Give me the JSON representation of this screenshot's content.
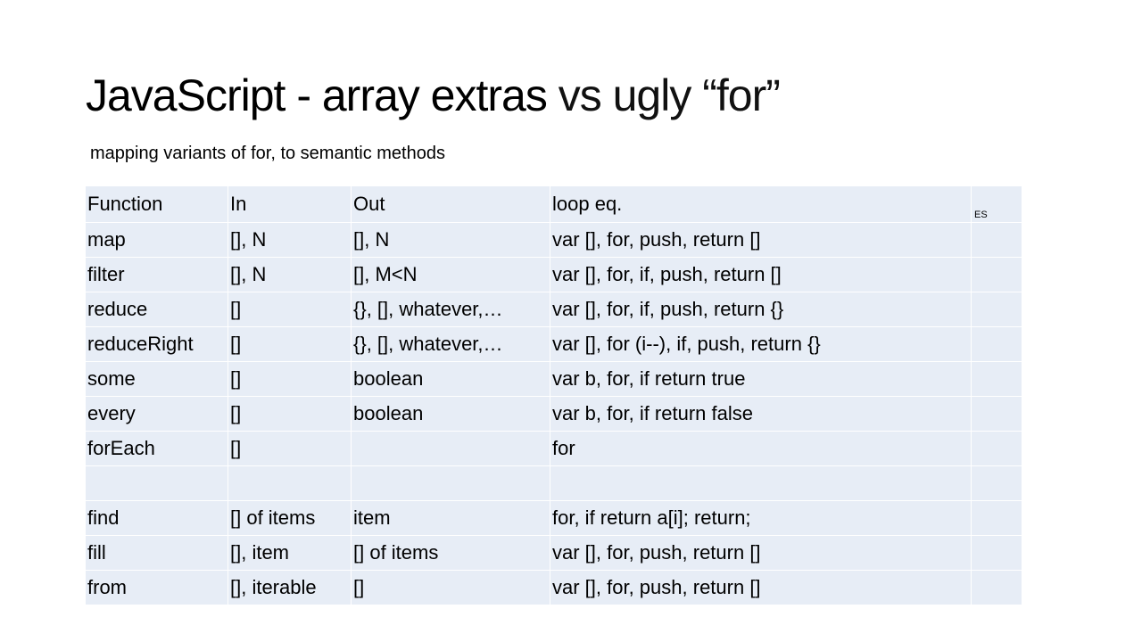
{
  "title": {
    "part1": "JavaScript - array extras",
    "part2": " vs ugly “for”"
  },
  "subtitle": "mapping variants of for, to semantic methods",
  "table": {
    "header": {
      "function": "Function",
      "in": "In",
      "out": "Out",
      "loop": "loop eq.",
      "es": "ES"
    },
    "rows": [
      {
        "function": "map",
        "in": "[], N",
        "out": "[], N",
        "loop": "var [], for, push, return []",
        "es": ""
      },
      {
        "function": "filter",
        "in": "[], N",
        "out": "[], M<N",
        "loop": "var [], for, if, push, return []",
        "es": ""
      },
      {
        "function": "reduce",
        "in": "[]",
        "out": "{}, [], whatever,…",
        "loop": "var [], for, if, push, return {}",
        "es": ""
      },
      {
        "function": "reduceRight",
        "in": "[]",
        "out": "{}, [], whatever,…",
        "loop": "var [], for (i--), if, push, return {}",
        "es": ""
      },
      {
        "function": "some",
        "in": "[]",
        "out": "boolean",
        "loop": "var b, for, if return true",
        "es": ""
      },
      {
        "function": "every",
        "in": "[]",
        "out": "boolean",
        "loop": "var b, for, if return false",
        "es": ""
      },
      {
        "function": "forEach",
        "in": "[]",
        "out": "",
        "loop": "for",
        "es": ""
      },
      {
        "function": "",
        "in": "",
        "out": "",
        "loop": "",
        "es": ""
      },
      {
        "function": "find",
        "in": "[] of items",
        "out": "item",
        "loop": "for, if return a[i]; return;",
        "es": ""
      },
      {
        "function": "fill",
        "in": "[], item",
        "out": "[] of items",
        "loop": "var [], for, push, return []",
        "es": ""
      },
      {
        "function": "from",
        "in": "[], iterable",
        "out": "[]",
        "loop": "var [], for, push, return []",
        "es": ""
      }
    ]
  }
}
